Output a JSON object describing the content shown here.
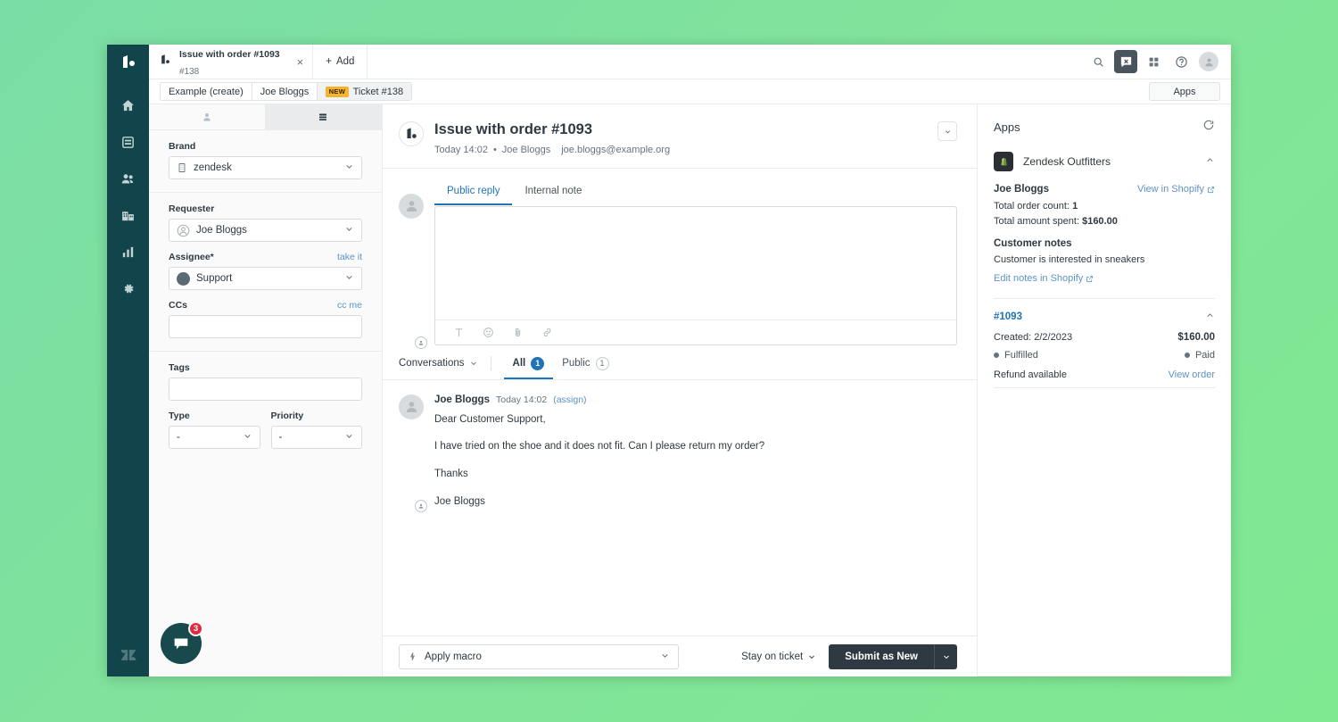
{
  "window": {
    "tab": {
      "title": "Issue with order #1093",
      "subtitle": "#138",
      "close": "×"
    },
    "add_tab_label": "Add",
    "add_tab_plus": "+"
  },
  "topbar_icons": {
    "search": "search-icon",
    "messaging": "messaging-icon",
    "apps_grid": "apps-grid-icon",
    "help": "help-icon",
    "avatar": "user-avatar-icon"
  },
  "breadcrumb": {
    "items": [
      {
        "label": "Example (create)",
        "badge": ""
      },
      {
        "label": "Joe Bloggs",
        "badge": ""
      },
      {
        "label": "Ticket #138",
        "badge": "NEW"
      }
    ],
    "apps_button": "Apps"
  },
  "nav_rail": {
    "items": [
      {
        "name": "home-icon",
        "label": "Home"
      },
      {
        "name": "views-icon",
        "label": "Views"
      },
      {
        "name": "customers-icon",
        "label": "Customers"
      },
      {
        "name": "organizations-icon",
        "label": "Organizations"
      },
      {
        "name": "reporting-icon",
        "label": "Reporting"
      },
      {
        "name": "settings-icon",
        "label": "Admin"
      }
    ]
  },
  "properties": {
    "tabs": [
      {
        "name": "user-tab",
        "active": false
      },
      {
        "name": "ticket-tab",
        "active": true
      }
    ],
    "brand": {
      "label": "Brand",
      "value": "zendesk"
    },
    "requester": {
      "label": "Requester",
      "value": "Joe Bloggs"
    },
    "assignee": {
      "label": "Assignee*",
      "value": "Support",
      "action": "take it"
    },
    "ccs": {
      "label": "CCs",
      "value": "",
      "action": "cc me"
    },
    "tags": {
      "label": "Tags",
      "value": ""
    },
    "type": {
      "label": "Type",
      "value": "-"
    },
    "priority": {
      "label": "Priority",
      "value": "-"
    }
  },
  "messenger": {
    "unread_count": "3"
  },
  "ticket": {
    "title": "Issue with order #1093",
    "time": "Today 14:02",
    "separator": "•",
    "author": "Joe Bloggs",
    "email": "joe.bloggs@example.org"
  },
  "composer": {
    "tabs": [
      {
        "label": "Public reply",
        "active": true
      },
      {
        "label": "Internal note",
        "active": false
      }
    ],
    "value": "",
    "toolbar": [
      {
        "name": "text-format-icon"
      },
      {
        "name": "emoji-icon"
      },
      {
        "name": "attachment-icon"
      },
      {
        "name": "link-icon"
      }
    ]
  },
  "conversation": {
    "dropdown_label": "Conversations",
    "tabs": [
      {
        "label": "All",
        "count": "1",
        "active": true,
        "style": "solid"
      },
      {
        "label": "Public",
        "count": "1",
        "active": false,
        "style": "outline"
      }
    ],
    "messages": [
      {
        "author": "Joe Bloggs",
        "time": "Today 14:02",
        "action": "(assign)",
        "paragraphs": [
          "Dear Customer Support,",
          "I have tried on the shoe and it does not fit. Can I please return my order?",
          "Thanks",
          "Joe Bloggs"
        ]
      }
    ]
  },
  "footer": {
    "macro_label": "Apply macro",
    "stay_label": "Stay on ticket",
    "submit_label": "Submit as New"
  },
  "apps": {
    "title": "Apps",
    "app_name": "Zendesk Outfitters",
    "customer": {
      "name": "Joe Bloggs",
      "view_link": "View in Shopify",
      "order_count_label": "Total order count:",
      "order_count_value": "1",
      "amount_label": "Total amount spent:",
      "amount_value": "$160.00",
      "notes_title": "Customer notes",
      "notes_text": "Customer is interested in sneakers",
      "edit_notes_link": "Edit notes in Shopify"
    },
    "order": {
      "id": "#1093",
      "created_label": "Created: 2/2/2023",
      "amount": "$160.00",
      "fulfillment_status": "Fulfilled",
      "payment_status": "Paid",
      "refund_label": "Refund available",
      "view_order_link": "View order"
    }
  },
  "colors": {
    "nav_rail": "#12454b",
    "accent_blue": "#1f73b7",
    "link_blue": "#5c93c4",
    "badge_orange": "#f5b32e",
    "submit_dark": "#2f3941",
    "badge_red": "#e02b3c",
    "background_green": "#7adda5"
  }
}
